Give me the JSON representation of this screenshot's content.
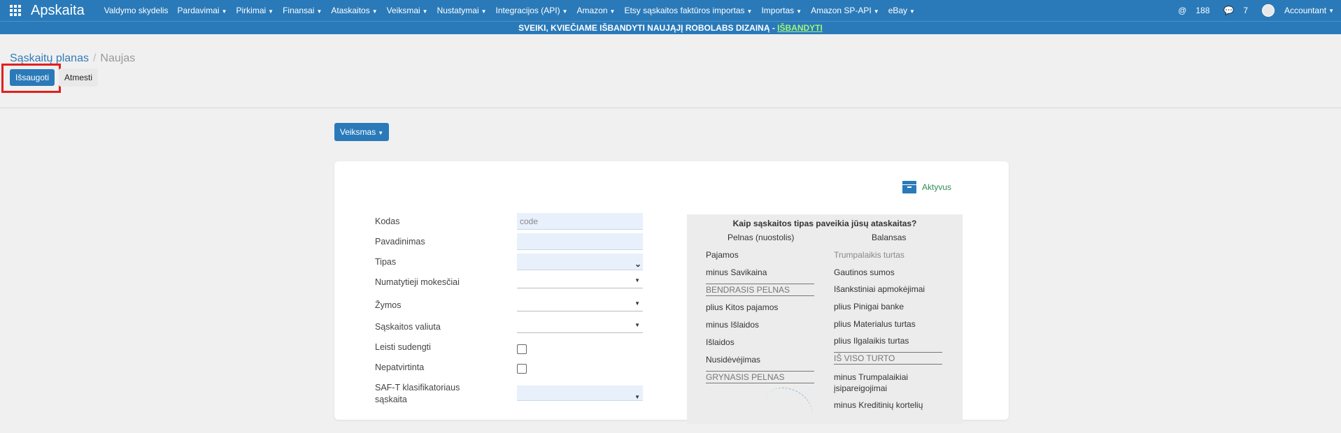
{
  "topbar": {
    "brand": "Apskaita",
    "menu": [
      {
        "label": "Valdymo skydelis",
        "dropdown": false
      },
      {
        "label": "Pardavimai",
        "dropdown": true
      },
      {
        "label": "Pirkimai",
        "dropdown": true
      },
      {
        "label": "Finansai",
        "dropdown": true
      },
      {
        "label": "Ataskaitos",
        "dropdown": true
      },
      {
        "label": "Veiksmai",
        "dropdown": true
      },
      {
        "label": "Nustatymai",
        "dropdown": true
      },
      {
        "label": "Integracijos (API)",
        "dropdown": true
      },
      {
        "label": "Amazon",
        "dropdown": true
      },
      {
        "label": "Etsy sąskaitos faktūros importas",
        "dropdown": true
      },
      {
        "label": "Importas",
        "dropdown": true
      },
      {
        "label": "Amazon SP-API",
        "dropdown": true
      },
      {
        "label": "eBay",
        "dropdown": true
      }
    ],
    "mentions_count": "188",
    "messages_count": "7",
    "user_name": "Accountant"
  },
  "banner": {
    "text": "SVEIKI, KVIEČIAME IŠBANDYTI NAUJĄJĮ ROBOLABS DIZAINĄ - ",
    "link": "IŠBANDYTI"
  },
  "breadcrumb": {
    "parent": "Sąskaitų planas",
    "current": "Naujas"
  },
  "buttons": {
    "save": "Išsaugoti",
    "discard": "Atmesti",
    "action": "Veiksmas"
  },
  "status": {
    "label": "Aktyvus"
  },
  "form": {
    "code_label": "Kodas",
    "code_placeholder": "code",
    "name_label": "Pavadinimas",
    "type_label": "Tipas",
    "taxes_label": "Numatytieji mokesčiai",
    "tags_label": "Žymos",
    "currency_label": "Sąskaitos valiuta",
    "reconcile_label": "Leisti sudengti",
    "deprecated_label": "Nepatvirtinta",
    "saft_label": "SAF-T klasifikatoriaus sąskaita"
  },
  "info_panel": {
    "title": "Kaip sąskaitos tipas paveikia jūsų ataskaitas?",
    "pl_header": "Pelnas (nuostolis)",
    "bs_header": "Balansas",
    "pl_items": {
      "income": "Pajamos",
      "cogs": "minus Savikaina",
      "gross": "BENDRASIS PELNAS",
      "other_income": "plius Kitos pajamos",
      "expenses": "minus Išlaidos",
      "expenses2": "Išlaidos",
      "depreciation": "Nusidėvėjimas",
      "net": "GRYNASIS PELNAS"
    },
    "bs_items": {
      "current_assets": "Trumpalaikis turtas",
      "receivables": "Gautinos sumos",
      "prepayments": "Išankstiniai apmokėjimai",
      "bank": "plius Pinigai banke",
      "tangible": "plius Materialus turtas",
      "noncurrent": "plius Ilgalaikis turtas",
      "total_assets": "IŠ VISO TURTO",
      "current_liabilities": "minus Trumpalaikiai įsipareigojimai",
      "credit_cards": "minus Kreditinių kortelių"
    }
  }
}
